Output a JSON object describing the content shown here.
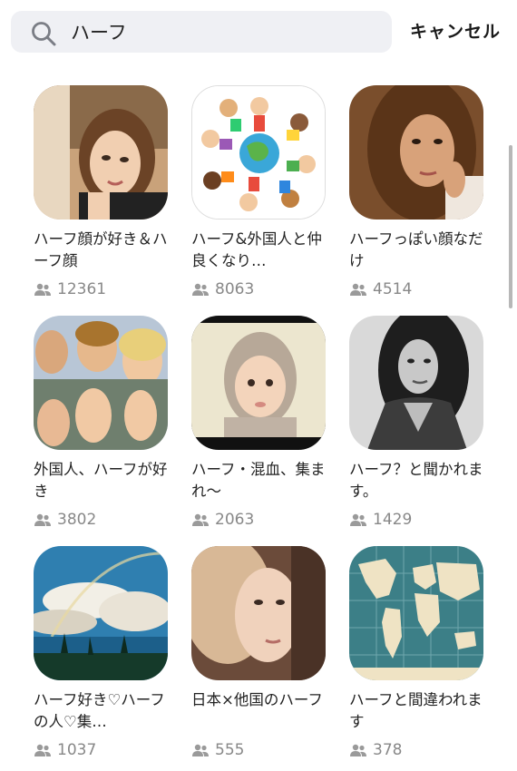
{
  "search": {
    "query": "ハーフ",
    "cancel_label": "キャンセル"
  },
  "groups": [
    {
      "title": "ハーフ顔が好き＆ハーフ顔",
      "members": "12361"
    },
    {
      "title": "ハーフ&外国人と仲良くなり…",
      "members": "8063"
    },
    {
      "title": "ハーフっぽい顔なだけ",
      "members": "4514"
    },
    {
      "title": "外国人、ハーフが好き",
      "members": "3802"
    },
    {
      "title": "ハーフ・混血、集まれ〜",
      "members": "2063"
    },
    {
      "title": "ハーフ？と聞かれます。",
      "members": "1429"
    },
    {
      "title": "ハーフ好き♡ハーフの人♡集…",
      "members": "1037"
    },
    {
      "title": "日本×他国のハーフ",
      "members": "555"
    },
    {
      "title": "ハーフと間違われます",
      "members": "378"
    }
  ],
  "icons": {
    "search": "search-icon",
    "members": "people-icon"
  }
}
